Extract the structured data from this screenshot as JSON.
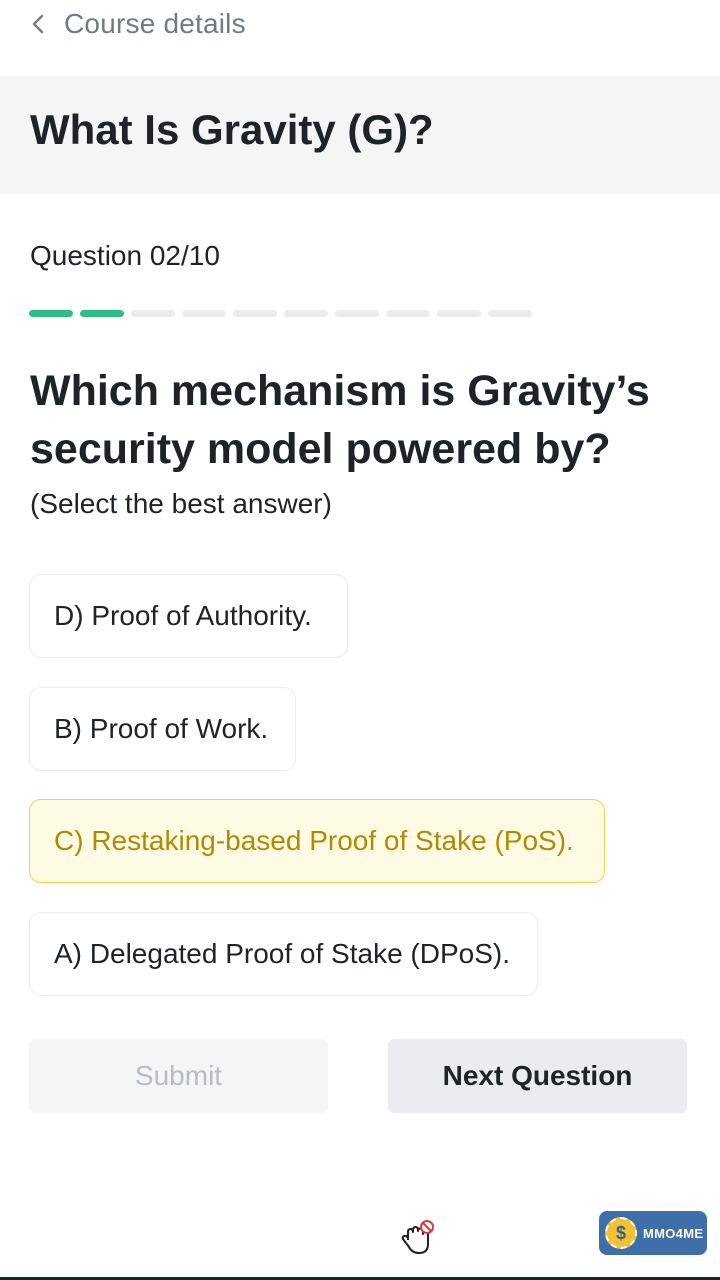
{
  "header": {
    "back_label": "Course details",
    "icon": "chevron-left-icon"
  },
  "course": {
    "title": "What Is Gravity (G)?"
  },
  "quiz": {
    "counter": "Question 02/10",
    "progress": {
      "current": 2,
      "total": 10
    },
    "question": "Which mechanism is Gravity’s security model powered by?",
    "hint": "(Select the best answer)",
    "options": [
      {
        "label": "D) Proof of Authority.",
        "selected": false
      },
      {
        "label": "B) Proof of Work.",
        "selected": false
      },
      {
        "label": "C) Restaking-based Proof of Stake (PoS).",
        "selected": true
      },
      {
        "label": "A) Delegated Proof of Stake (DPoS).",
        "selected": false
      }
    ]
  },
  "actions": {
    "submit_label": "Submit",
    "next_label": "Next Question"
  },
  "watermark": {
    "symbol": "$",
    "name": "MMO4ME"
  },
  "colors": {
    "progress_done": "#2ebd85",
    "progress_todo": "#eaecef",
    "selected_bg": "#fefbe5",
    "selected_border": "#f0d54a",
    "selected_text": "#b28a00",
    "muted_text": "#707a8a"
  }
}
